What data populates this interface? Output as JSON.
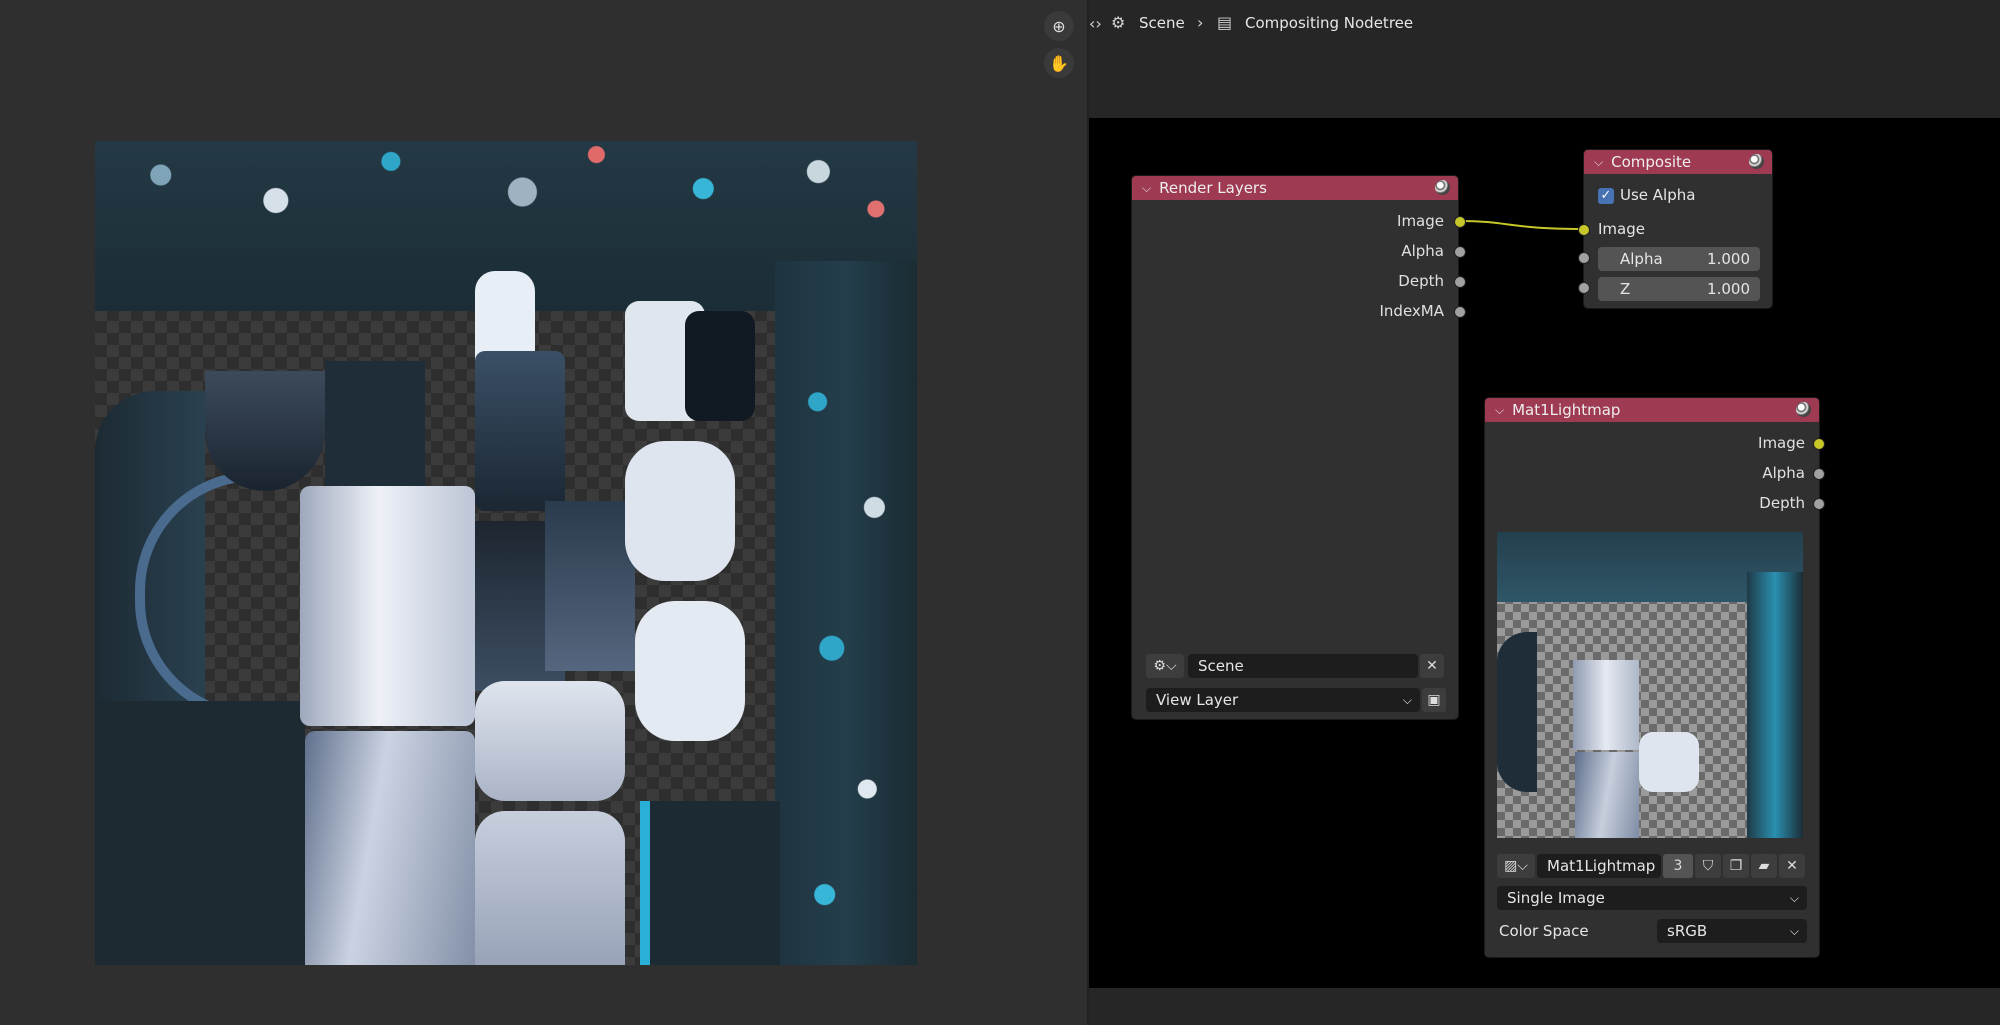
{
  "breadcrumb": {
    "scene": "Scene",
    "nodetree": "Compositing Nodetree"
  },
  "render_layers": {
    "title": "Render Layers",
    "outputs": [
      "Image",
      "Alpha",
      "Depth",
      "IndexMA"
    ],
    "scene_field": "Scene",
    "view_layer": "View Layer"
  },
  "composite": {
    "title": "Composite",
    "use_alpha_label": "Use Alpha",
    "use_alpha_checked": true,
    "image_input": "Image",
    "alpha_label": "Alpha",
    "alpha_value": "1.000",
    "z_label": "Z",
    "z_value": "1.000"
  },
  "mat_node": {
    "title": "Mat1Lightmap",
    "outputs": [
      "Image",
      "Alpha",
      "Depth"
    ],
    "image_name": "Mat1Lightmap",
    "users": "3",
    "source": "Single Image",
    "color_space_label": "Color Space",
    "color_space_value": "sRGB"
  },
  "colors": {
    "node_header": "#9e3a52",
    "socket_color": "#c7c729",
    "link_color": "#c7c729",
    "accent": "#4772b3"
  }
}
